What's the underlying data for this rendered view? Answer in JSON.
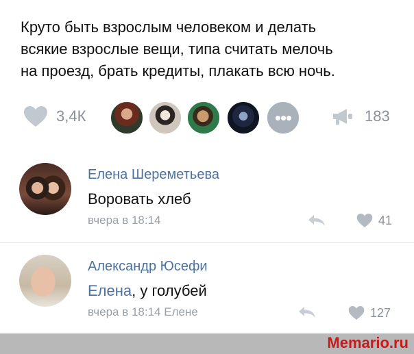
{
  "post": {
    "lines": [
      "Круто быть взрослым человеком и делать",
      "всякие взрослые вещи, типа считать мелочь",
      "на проезд, брать кредиты, плакать всю ночь."
    ]
  },
  "stats": {
    "likes": "3,4К",
    "shares": "183",
    "more_glyph": "•••",
    "icons": {
      "like": "heart-icon",
      "share": "megaphone-icon"
    }
  },
  "comments": [
    {
      "author": "Елена Шереметьева",
      "text": "Воровать хлеб",
      "time": "вчера в 18:14",
      "likes": "41"
    },
    {
      "author": "Александр Юсефи",
      "mention": "Елена",
      "text": ", у голубей",
      "time": "вчера в 18:14 Елене",
      "likes": "127"
    }
  ],
  "watermark": "Memario.ru",
  "colors": {
    "link": "#4b72a0",
    "muted": "#8a9099",
    "watermark": "#c81a1a"
  }
}
